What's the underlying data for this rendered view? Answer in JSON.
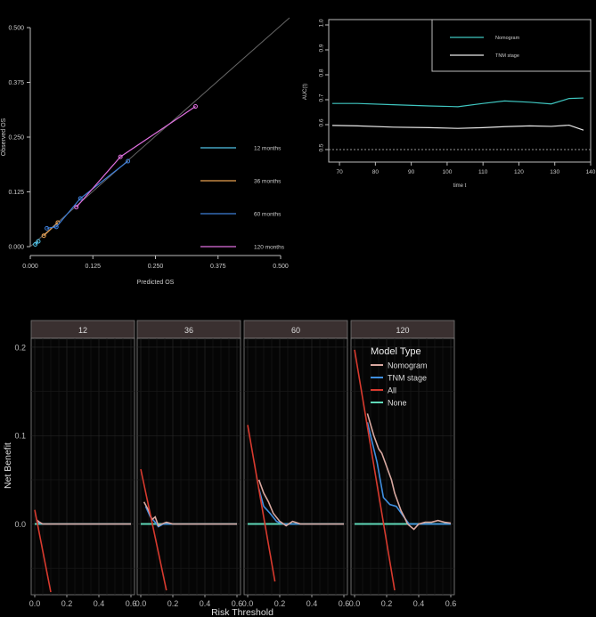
{
  "chart_data": [
    {
      "type": "scatter",
      "xlabel": "Predicted OS",
      "ylabel": "Observed OS",
      "xlim": [
        0,
        0.5
      ],
      "ylim": [
        0,
        0.5
      ],
      "xticks": [
        "0.000",
        "0.125",
        "0.250",
        "0.375",
        "0.500"
      ],
      "yticks": [
        "0.000",
        "0.125",
        "0.250",
        "0.375",
        "0.500"
      ],
      "reference_line": "y = x",
      "legend_placement": "right",
      "series": [
        {
          "name": "12 months",
          "color": "#4fc3e8",
          "points": [
            [
              0.01,
              0.005
            ],
            [
              0.016,
              0.012
            ]
          ]
        },
        {
          "name": "36 months",
          "color": "#e8a050",
          "points": [
            [
              0.027,
              0.025
            ],
            [
              0.055,
              0.055
            ]
          ]
        },
        {
          "name": "60 months",
          "color": "#3f7fd8",
          "points": [
            [
              0.033,
              0.042
            ],
            [
              0.052,
              0.045
            ],
            [
              0.1,
              0.11
            ],
            [
              0.195,
              0.195
            ]
          ]
        },
        {
          "name": "120 months",
          "color": "#e070e0",
          "points": [
            [
              0.092,
              0.09
            ],
            [
              0.18,
              0.205
            ],
            [
              0.33,
              0.32
            ]
          ]
        }
      ]
    },
    {
      "type": "line",
      "xlabel": "time t",
      "ylabel": "AUC(t)",
      "xlim": [
        67,
        140
      ],
      "ylim": [
        0.45,
        1.0
      ],
      "xticks": [
        "70",
        "80",
        "90",
        "100",
        "110",
        "120",
        "130",
        "140"
      ],
      "yticks": [
        "0.5",
        "0.6",
        "0.7",
        "0.8",
        "0.9",
        "1.0"
      ],
      "reference_y": 0.5,
      "legend_placement": "top-right",
      "series": [
        {
          "name": "Nomogram",
          "color": "#3fc6c0",
          "x": [
            68,
            75,
            85,
            95,
            103,
            110,
            116,
            123,
            129,
            134,
            138
          ],
          "y": [
            0.685,
            0.685,
            0.68,
            0.675,
            0.672,
            0.685,
            0.695,
            0.69,
            0.683,
            0.705,
            0.707
          ]
        },
        {
          "name": "TNM stage",
          "color": "#e8e8e8",
          "x": [
            68,
            75,
            85,
            95,
            103,
            110,
            116,
            123,
            129,
            134,
            138
          ],
          "y": [
            0.597,
            0.595,
            0.59,
            0.588,
            0.585,
            0.588,
            0.592,
            0.595,
            0.593,
            0.598,
            0.578
          ]
        }
      ]
    },
    {
      "type": "line",
      "xlabel": "Risk Threshold",
      "ylabel": "Net Benefit",
      "xlim": [
        0,
        0.6
      ],
      "ylim": [
        -0.08,
        0.21
      ],
      "xticks": [
        "0.0",
        "0.2",
        "0.4",
        "0.6"
      ],
      "yticks": [
        "0.0",
        "0.1",
        "0.2"
      ],
      "legend_title": "Model Type",
      "legend_placement": "top-right",
      "legend": [
        {
          "name": "Nomogram",
          "color": "#d8a8a0"
        },
        {
          "name": "TNM stage",
          "color": "#3f8fe0"
        },
        {
          "name": "All",
          "color": "#d83a2e"
        },
        {
          "name": "None",
          "color": "#5fd8b8"
        }
      ],
      "panels": [
        {
          "title": "12",
          "nomogram": [
            [
              0.01,
              0.005
            ],
            [
              0.03,
              0.002
            ],
            [
              0.05,
              0.0
            ],
            [
              0.07,
              0.0
            ],
            [
              0.6,
              0.0
            ]
          ],
          "tnm": [
            [
              0.01,
              0.004
            ],
            [
              0.03,
              0.001
            ],
            [
              0.05,
              0.0
            ],
            [
              0.6,
              0.0
            ]
          ],
          "all": [
            [
              0.0,
              0.016
            ],
            [
              0.1,
              -0.077
            ]
          ]
        },
        {
          "title": "36",
          "nomogram": [
            [
              0.02,
              0.025
            ],
            [
              0.05,
              0.015
            ],
            [
              0.07,
              0.005
            ],
            [
              0.09,
              0.008
            ],
            [
              0.11,
              -0.002
            ],
            [
              0.13,
              0.0
            ],
            [
              0.16,
              0.002
            ],
            [
              0.2,
              0.0
            ],
            [
              0.6,
              0.0
            ]
          ],
          "tnm": [
            [
              0.03,
              0.02
            ],
            [
              0.06,
              0.008
            ],
            [
              0.09,
              0.002
            ],
            [
              0.11,
              -0.003
            ],
            [
              0.14,
              0.0
            ],
            [
              0.6,
              0.0
            ]
          ],
          "all": [
            [
              0.0,
              0.062
            ],
            [
              0.16,
              -0.075
            ]
          ]
        },
        {
          "title": "60",
          "nomogram": [
            [
              0.07,
              0.05
            ],
            [
              0.1,
              0.035
            ],
            [
              0.13,
              0.025
            ],
            [
              0.16,
              0.012
            ],
            [
              0.2,
              0.003
            ],
            [
              0.24,
              -0.002
            ],
            [
              0.28,
              0.003
            ],
            [
              0.33,
              0.0
            ],
            [
              0.6,
              0.0
            ]
          ],
          "tnm": [
            [
              0.07,
              0.04
            ],
            [
              0.1,
              0.02
            ],
            [
              0.14,
              0.012
            ],
            [
              0.18,
              0.003
            ],
            [
              0.22,
              0.0
            ],
            [
              0.6,
              0.0
            ]
          ],
          "all": [
            [
              0.0,
              0.112
            ],
            [
              0.17,
              -0.065
            ]
          ]
        },
        {
          "title": "120",
          "nomogram": [
            [
              0.08,
              0.125
            ],
            [
              0.12,
              0.1
            ],
            [
              0.15,
              0.085
            ],
            [
              0.17,
              0.08
            ],
            [
              0.19,
              0.07
            ],
            [
              0.21,
              0.06
            ],
            [
              0.23,
              0.05
            ],
            [
              0.25,
              0.035
            ],
            [
              0.27,
              0.025
            ],
            [
              0.29,
              0.015
            ],
            [
              0.31,
              0.008
            ],
            [
              0.33,
              0.0
            ],
            [
              0.35,
              -0.003
            ],
            [
              0.37,
              -0.006
            ],
            [
              0.4,
              0.0
            ],
            [
              0.44,
              0.002
            ],
            [
              0.48,
              0.002
            ],
            [
              0.52,
              0.004
            ],
            [
              0.56,
              0.002
            ],
            [
              0.6,
              0.001
            ]
          ],
          "tnm": [
            [
              0.08,
              0.115
            ],
            [
              0.14,
              0.07
            ],
            [
              0.18,
              0.03
            ],
            [
              0.22,
              0.022
            ],
            [
              0.26,
              0.02
            ],
            [
              0.3,
              0.01
            ],
            [
              0.34,
              0.0
            ],
            [
              0.4,
              0.0
            ],
            [
              0.6,
              0.0
            ]
          ],
          "all": [
            [
              0.0,
              0.197
            ],
            [
              0.25,
              -0.075
            ]
          ]
        }
      ]
    }
  ]
}
